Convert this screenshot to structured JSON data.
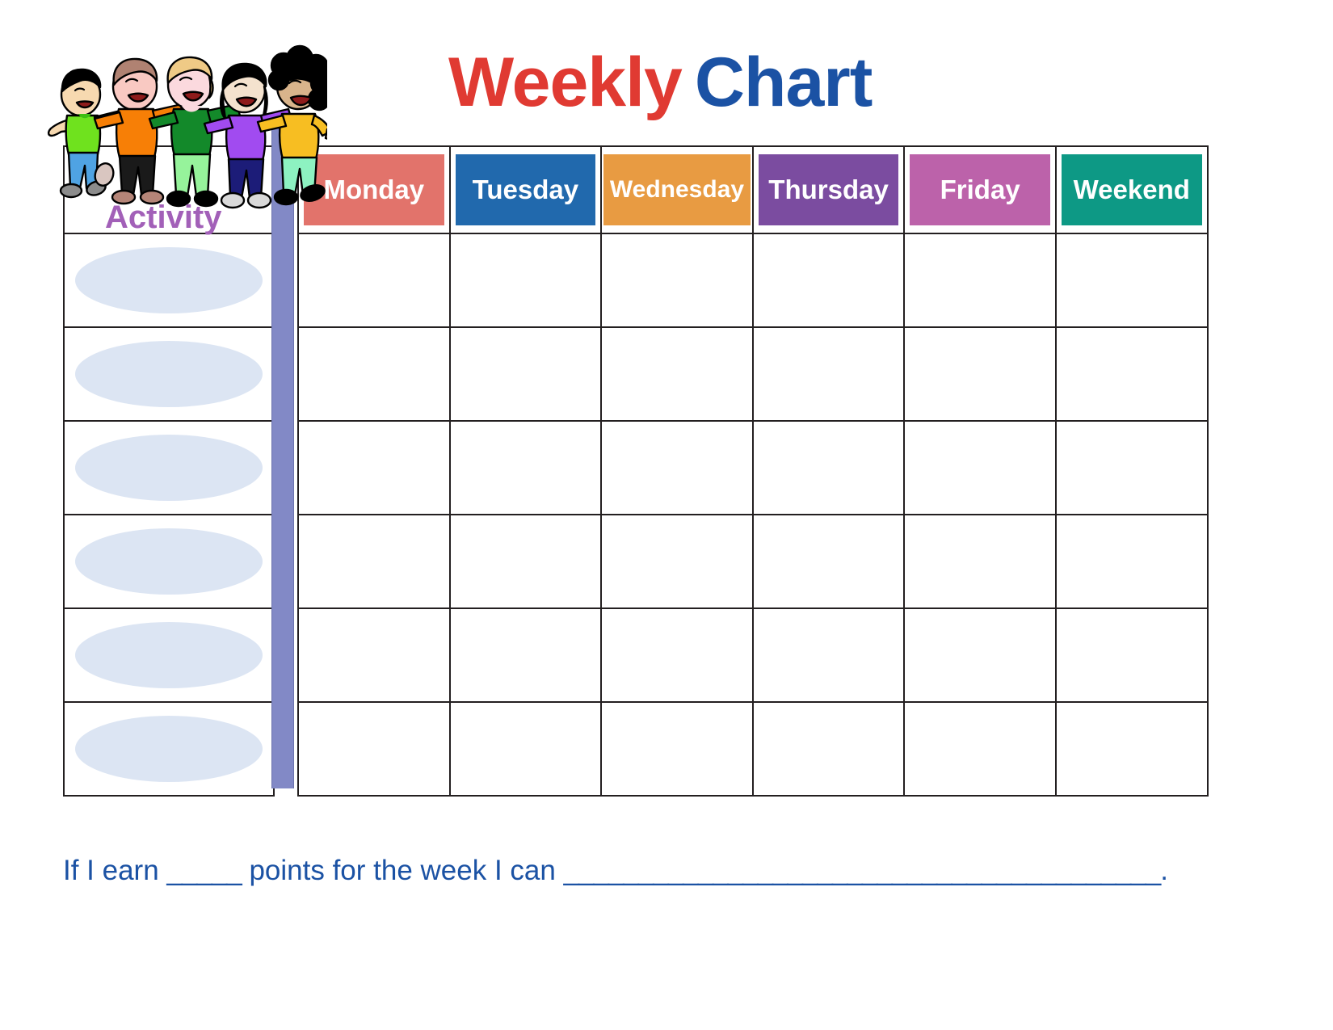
{
  "page": {
    "title_part1": "Weekly",
    "title_part2": "Chart",
    "title_color_1": "#E03A32",
    "title_color_2": "#1B52A4",
    "background": "#FFFFFF"
  },
  "clipart": {
    "name": "five-children-hugging",
    "children": [
      {
        "hair": "#000000",
        "skin": "#F7D9B0",
        "shirt": "#6FE21E",
        "pants": "#4FA3E3",
        "shoes": "#8C8C8C"
      },
      {
        "hair": "#B08272",
        "skin": "#F9C9C2",
        "shirt": "#F77F06",
        "pants": "#1A1A1A",
        "shoes": "#B58578"
      },
      {
        "hair": "#EFCA86",
        "skin": "#FBD9DE",
        "shirt": "#13892A",
        "pants": "#96F39B",
        "shoes": "#000000"
      },
      {
        "hair": "#000000",
        "skin": "#F4E2CE",
        "shirt": "#A14BF0",
        "pants": "#1C1C78",
        "shoes": "#D9D9D9"
      },
      {
        "hair": "#000000",
        "skin": "#D9B48B",
        "shirt": "#F7BE22",
        "pants": "#8DF2C1",
        "shoes": "#000000"
      }
    ]
  },
  "table": {
    "activity_header_label": "Activity",
    "activity_header_color": "#A260B8",
    "day_headers": [
      {
        "label": "Monday",
        "color": "#E2736B"
      },
      {
        "label": "Tuesday",
        "color": "#2169AD"
      },
      {
        "label": "Wednesday",
        "color": "#E89B42"
      },
      {
        "label": "Thursday",
        "color": "#7B4CA0"
      },
      {
        "label": "Friday",
        "color": "#BC62AA"
      },
      {
        "label": "Weekend",
        "color": "#0D9985"
      }
    ],
    "row_count": 6,
    "activity_ellipse_color": "#DCE5F3",
    "divider_bar_color": "#8289C6",
    "border_color": "#231F20",
    "rows": [
      {
        "activity": "",
        "cells": [
          "",
          "",
          "",
          "",
          "",
          ""
        ]
      },
      {
        "activity": "",
        "cells": [
          "",
          "",
          "",
          "",
          "",
          ""
        ]
      },
      {
        "activity": "",
        "cells": [
          "",
          "",
          "",
          "",
          "",
          ""
        ]
      },
      {
        "activity": "",
        "cells": [
          "",
          "",
          "",
          "",
          "",
          ""
        ]
      },
      {
        "activity": "",
        "cells": [
          "",
          "",
          "",
          "",
          "",
          ""
        ]
      },
      {
        "activity": "",
        "cells": [
          "",
          "",
          "",
          "",
          "",
          ""
        ]
      }
    ]
  },
  "footer": {
    "text_before_blank": "If I earn ",
    "blank_short": "_____",
    "text_middle": " points for the week I can ",
    "blank_long": "________________________________________",
    "text_end": ".",
    "color": "#1B52A4"
  }
}
